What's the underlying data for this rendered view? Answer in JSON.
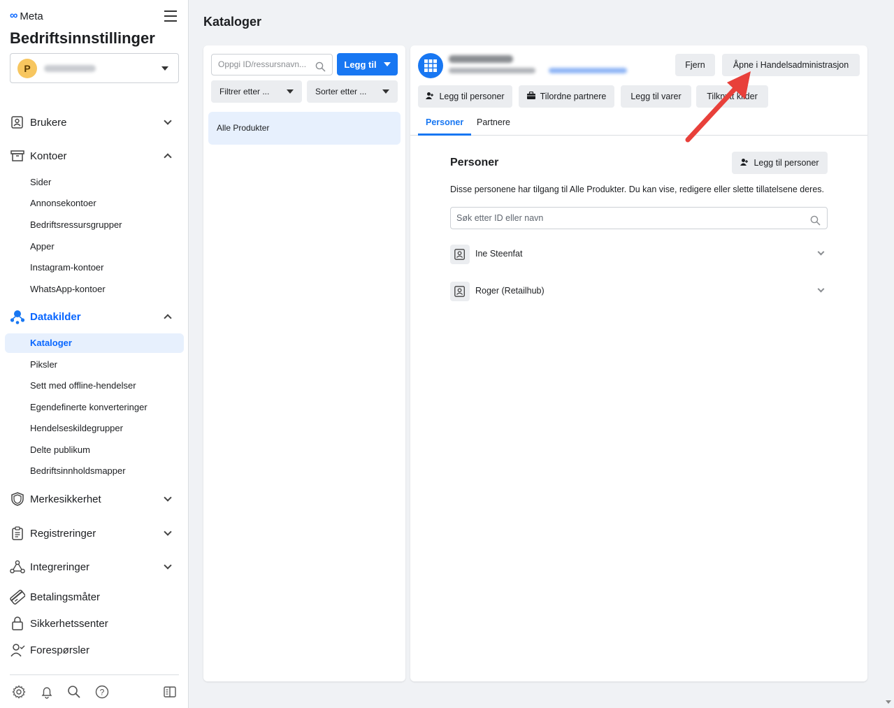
{
  "sidebar": {
    "brand": "Meta",
    "title": "Bedriftsinnstillinger",
    "business": {
      "avatar_letter": "P"
    },
    "groups": [
      {
        "label": "Brukere",
        "icon": "users-icon",
        "expanded": false
      },
      {
        "label": "Kontoer",
        "icon": "accounts-icon",
        "expanded": true,
        "items": [
          "Sider",
          "Annonsekontoer",
          "Bedriftsressursgrupper",
          "Apper",
          "Instagram-kontoer",
          "WhatsApp-kontoer"
        ]
      },
      {
        "label": "Datakilder",
        "icon": "data-sources-icon",
        "expanded": true,
        "active": true,
        "items": [
          "Kataloger",
          "Piksler",
          "Sett med offline-hendelser",
          "Egendefinerte konverteringer",
          "Hendelseskildegrupper",
          "Delte publikum",
          "Bedriftsinnholdsmapper"
        ],
        "active_item": "Kataloger"
      },
      {
        "label": "Merkesikkerhet",
        "icon": "shield-icon",
        "expanded": false
      },
      {
        "label": "Registreringer",
        "icon": "clipboard-icon",
        "expanded": false
      },
      {
        "label": "Integreringer",
        "icon": "integrations-icon",
        "expanded": false
      },
      {
        "label": "Betalingsmåter",
        "icon": "card-icon"
      },
      {
        "label": "Sikkerhetssenter",
        "icon": "lock-icon"
      },
      {
        "label": "Forespørsler",
        "icon": "requests-icon"
      }
    ]
  },
  "page": {
    "title": "Kataloger"
  },
  "left_panel": {
    "search_placeholder": "Oppgi ID/ressursnavn...",
    "add_button": "Legg til",
    "filter_label": "Filtrer etter ...",
    "sort_label": "Sorter etter ...",
    "catalogs": [
      "Alle Produkter"
    ]
  },
  "right_panel": {
    "remove_button": "Fjern",
    "open_commerce_button": "Åpne i Handelsadministrasjon",
    "actions": [
      "Legg til personer",
      "Tilordne partnere",
      "Legg til varer",
      "Tilknytt kilder"
    ],
    "tabs": [
      "Personer",
      "Partnere"
    ],
    "active_tab": "Personer",
    "section": {
      "title": "Personer",
      "add_people_button": "Legg til personer",
      "description": "Disse personene har tilgang til Alle Produkter. Du kan vise, redigere eller slette tillatelsene deres.",
      "search_placeholder": "Søk etter ID eller navn",
      "people": [
        "Ine Steenfat",
        "Roger (Retailhub)"
      ]
    }
  },
  "annotation": {
    "arrow_color": "#e8403a"
  }
}
